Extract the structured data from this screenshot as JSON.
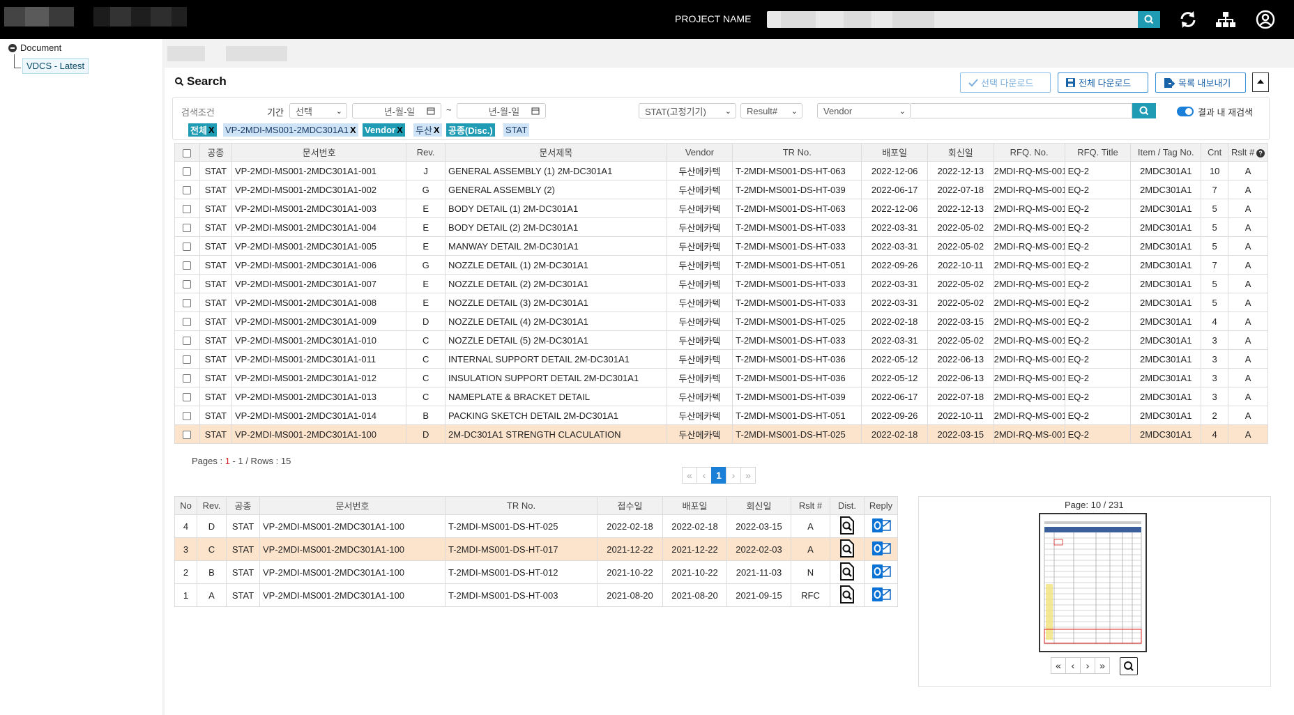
{
  "header": {
    "project_label": "PROJECT NAME",
    "project_input_value": ""
  },
  "sidebar": {
    "root": "Document",
    "items": [
      {
        "label": "VDCS - Latest",
        "selected": true
      }
    ]
  },
  "search": {
    "title": "Search",
    "buttons": {
      "selected_download": "선택 다운로드",
      "all_download": "전체 다운로드",
      "export_list": "목록 내보내기"
    },
    "filters": {
      "condition_label": "검색조건",
      "period_label": "기간",
      "period_select": "선택",
      "date_from_placeholder": "년-월-일",
      "date_sep": "~",
      "date_to_placeholder": "년-월-일",
      "discipline_select": "STAT(고정기기)",
      "result_select": "Result#",
      "vendor_select": "Vendor",
      "vendor_input": "",
      "refine_label": "결과 내 재검색",
      "refine_on": true
    },
    "chips": [
      {
        "label": "전체",
        "style": "teal",
        "x": "X"
      },
      {
        "label": "VP-2MDI-MS001-2MDC301A1",
        "style": "blue",
        "x": "X"
      },
      {
        "label": "Vendor",
        "style": "teal",
        "x": "X"
      },
      {
        "label": "두산",
        "style": "blue",
        "x": "X"
      },
      {
        "label": "공종(Disc.)",
        "style": "teal",
        "x": ""
      },
      {
        "label": "STAT",
        "style": "blue",
        "x": ""
      }
    ]
  },
  "doc_table": {
    "columns": [
      "",
      "공종",
      "문서번호",
      "Rev.",
      "문서제목",
      "Vendor",
      "TR No.",
      "배포일",
      "회신일",
      "RFQ. No.",
      "RFQ. Title",
      "Item / Tag No.",
      "Cnt",
      "Rslt #"
    ],
    "rows": [
      [
        "STAT",
        "VP-2MDI-MS001-2MDC301A1-001",
        "J",
        "GENERAL ASSEMBLY (1) 2M-DC301A1",
        "두산메카텍",
        "T-2MDI-MS001-DS-HT-063",
        "2022-12-06",
        "2022-12-13",
        "2MDI-RQ-MS-001",
        "EQ-2",
        "2MDC301A1",
        "10",
        "A"
      ],
      [
        "STAT",
        "VP-2MDI-MS001-2MDC301A1-002",
        "G",
        "GENERAL ASSEMBLY (2)",
        "두산메카텍",
        "T-2MDI-MS001-DS-HT-039",
        "2022-06-17",
        "2022-07-18",
        "2MDI-RQ-MS-001",
        "EQ-2",
        "2MDC301A1",
        "7",
        "A"
      ],
      [
        "STAT",
        "VP-2MDI-MS001-2MDC301A1-003",
        "E",
        "BODY DETAIL (1) 2M-DC301A1",
        "두산메카텍",
        "T-2MDI-MS001-DS-HT-063",
        "2022-12-06",
        "2022-12-13",
        "2MDI-RQ-MS-001",
        "EQ-2",
        "2MDC301A1",
        "5",
        "A"
      ],
      [
        "STAT",
        "VP-2MDI-MS001-2MDC301A1-004",
        "E",
        "BODY DETAIL (2) 2M-DC301A1",
        "두산메카텍",
        "T-2MDI-MS001-DS-HT-033",
        "2022-03-31",
        "2022-05-02",
        "2MDI-RQ-MS-001",
        "EQ-2",
        "2MDC301A1",
        "5",
        "A"
      ],
      [
        "STAT",
        "VP-2MDI-MS001-2MDC301A1-005",
        "E",
        "MANWAY DETAIL 2M-DC301A1",
        "두산메카텍",
        "T-2MDI-MS001-DS-HT-033",
        "2022-03-31",
        "2022-05-02",
        "2MDI-RQ-MS-001",
        "EQ-2",
        "2MDC301A1",
        "5",
        "A"
      ],
      [
        "STAT",
        "VP-2MDI-MS001-2MDC301A1-006",
        "G",
        "NOZZLE DETAIL (1) 2M-DC301A1",
        "두산메카텍",
        "T-2MDI-MS001-DS-HT-051",
        "2022-09-26",
        "2022-10-11",
        "2MDI-RQ-MS-001",
        "EQ-2",
        "2MDC301A1",
        "7",
        "A"
      ],
      [
        "STAT",
        "VP-2MDI-MS001-2MDC301A1-007",
        "E",
        "NOZZLE DETAIL (2) 2M-DC301A1",
        "두산메카텍",
        "T-2MDI-MS001-DS-HT-033",
        "2022-03-31",
        "2022-05-02",
        "2MDI-RQ-MS-001",
        "EQ-2",
        "2MDC301A1",
        "5",
        "A"
      ],
      [
        "STAT",
        "VP-2MDI-MS001-2MDC301A1-008",
        "E",
        "NOZZLE DETAIL (3) 2M-DC301A1",
        "두산메카텍",
        "T-2MDI-MS001-DS-HT-033",
        "2022-03-31",
        "2022-05-02",
        "2MDI-RQ-MS-001",
        "EQ-2",
        "2MDC301A1",
        "5",
        "A"
      ],
      [
        "STAT",
        "VP-2MDI-MS001-2MDC301A1-009",
        "D",
        "NOZZLE DETAIL (4) 2M-DC301A1",
        "두산메카텍",
        "T-2MDI-MS001-DS-HT-025",
        "2022-02-18",
        "2022-03-15",
        "2MDI-RQ-MS-001",
        "EQ-2",
        "2MDC301A1",
        "4",
        "A"
      ],
      [
        "STAT",
        "VP-2MDI-MS001-2MDC301A1-010",
        "C",
        "NOZZLE DETAIL (5) 2M-DC301A1",
        "두산메카텍",
        "T-2MDI-MS001-DS-HT-033",
        "2022-03-31",
        "2022-05-02",
        "2MDI-RQ-MS-001",
        "EQ-2",
        "2MDC301A1",
        "3",
        "A"
      ],
      [
        "STAT",
        "VP-2MDI-MS001-2MDC301A1-011",
        "C",
        "INTERNAL SUPPORT DETAIL 2M-DC301A1",
        "두산메카텍",
        "T-2MDI-MS001-DS-HT-036",
        "2022-05-12",
        "2022-06-13",
        "2MDI-RQ-MS-001",
        "EQ-2",
        "2MDC301A1",
        "3",
        "A"
      ],
      [
        "STAT",
        "VP-2MDI-MS001-2MDC301A1-012",
        "C",
        "INSULATION SUPPORT DETAIL 2M-DC301A1",
        "두산메카텍",
        "T-2MDI-MS001-DS-HT-036",
        "2022-05-12",
        "2022-06-13",
        "2MDI-RQ-MS-001",
        "EQ-2",
        "2MDC301A1",
        "3",
        "A"
      ],
      [
        "STAT",
        "VP-2MDI-MS001-2MDC301A1-013",
        "C",
        "NAMEPLATE & BRACKET DETAIL",
        "두산메카텍",
        "T-2MDI-MS001-DS-HT-039",
        "2022-06-17",
        "2022-07-18",
        "2MDI-RQ-MS-001",
        "EQ-2",
        "2MDC301A1",
        "3",
        "A"
      ],
      [
        "STAT",
        "VP-2MDI-MS001-2MDC301A1-014",
        "B",
        "PACKING SKETCH DETAIL 2M-DC301A1",
        "두산메카텍",
        "T-2MDI-MS001-DS-HT-051",
        "2022-09-26",
        "2022-10-11",
        "2MDI-RQ-MS-001",
        "EQ-2",
        "2MDC301A1",
        "2",
        "A"
      ],
      [
        "STAT",
        "VP-2MDI-MS001-2MDC301A1-100",
        "D",
        "2M-DC301A1 STRENGTH CLACULATION",
        "두산메카텍",
        "T-2MDI-MS001-DS-HT-025",
        "2022-02-18",
        "2022-03-15",
        "2MDI-RQ-MS-001",
        "EQ-2",
        "2MDC301A1",
        "4",
        "A"
      ]
    ],
    "highlighted_row": 14
  },
  "pagination": {
    "pages_label": "Pages : ",
    "current": "1",
    "rest": " - 1 / Rows : 15",
    "buttons": [
      "«",
      "‹",
      "1",
      "›",
      "»"
    ]
  },
  "history_table": {
    "columns": [
      "No",
      "Rev.",
      "공종",
      "문서번호",
      "TR No.",
      "접수일",
      "배포일",
      "회신일",
      "Rslt #",
      "Dist.",
      "Reply"
    ],
    "rows": [
      [
        "4",
        "D",
        "STAT",
        "VP-2MDI-MS001-2MDC301A1-100",
        "T-2MDI-MS001-DS-HT-025",
        "2022-02-18",
        "2022-02-18",
        "2022-03-15",
        "A"
      ],
      [
        "3",
        "C",
        "STAT",
        "VP-2MDI-MS001-2MDC301A1-100",
        "T-2MDI-MS001-DS-HT-017",
        "2021-12-22",
        "2021-12-22",
        "2022-02-03",
        "A"
      ],
      [
        "2",
        "B",
        "STAT",
        "VP-2MDI-MS001-2MDC301A1-100",
        "T-2MDI-MS001-DS-HT-012",
        "2021-10-22",
        "2021-10-22",
        "2021-11-03",
        "N"
      ],
      [
        "1",
        "A",
        "STAT",
        "VP-2MDI-MS001-2MDC301A1-100",
        "T-2MDI-MS001-DS-HT-003",
        "2021-08-20",
        "2021-08-20",
        "2021-09-15",
        "RFC"
      ]
    ],
    "highlighted_row": 1,
    "dist_icon": "document-search-icon",
    "reply_icon": "outlook-mail-icon"
  },
  "preview": {
    "page_label": "Page: 10 / 231",
    "nav": [
      "«",
      "‹",
      "›",
      "»"
    ],
    "zoom_icon": "search-icon"
  },
  "colors": {
    "accent_teal": "#1f9bb4",
    "accent_blue": "#1a7fd6",
    "highlight_row": "#fbe3cc",
    "topbar": "#000000"
  }
}
